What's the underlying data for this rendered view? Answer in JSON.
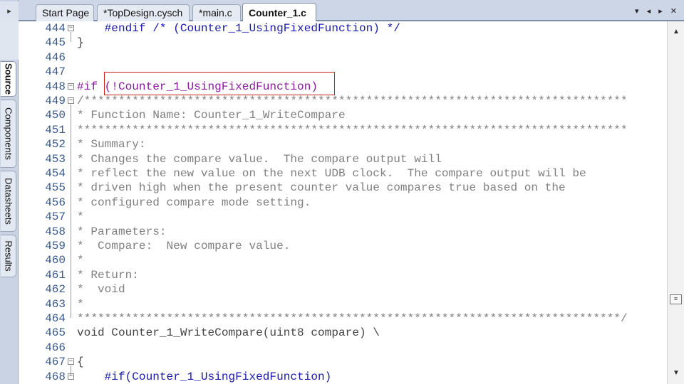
{
  "tabs": [
    {
      "label": "Start Page",
      "active": false
    },
    {
      "label": "*TopDesign.cysch",
      "active": false
    },
    {
      "label": "*main.c",
      "active": false
    },
    {
      "label": "Counter_1.c",
      "active": true
    }
  ],
  "tab_controls": "▾ ◂ ▸ ✕",
  "side_tabs": [
    "Source",
    "Components",
    "Datasheets",
    "Results"
  ],
  "lines": [
    {
      "num": "444",
      "text": "    #endif /* (Counter_1_UsingFixedFunction) */"
    },
    {
      "num": "445",
      "text": "}"
    },
    {
      "num": "446",
      "text": ""
    },
    {
      "num": "447",
      "text": ""
    },
    {
      "num": "448",
      "text": "#if (!Counter_1_UsingFixedFunction)"
    },
    {
      "num": "449",
      "text": "/*******************************************************************************"
    },
    {
      "num": "450",
      "text": "* Function Name: Counter_1_WriteCompare"
    },
    {
      "num": "451",
      "text": "********************************************************************************"
    },
    {
      "num": "452",
      "text": "* Summary:"
    },
    {
      "num": "453",
      "text": "* Changes the compare value.  The compare output will"
    },
    {
      "num": "454",
      "text": "* reflect the new value on the next UDB clock.  The compare output will be"
    },
    {
      "num": "455",
      "text": "* driven high when the present counter value compares true based on the"
    },
    {
      "num": "456",
      "text": "* configured compare mode setting."
    },
    {
      "num": "457",
      "text": "*"
    },
    {
      "num": "458",
      "text": "* Parameters:"
    },
    {
      "num": "459",
      "text": "*  Compare:  New compare value."
    },
    {
      "num": "460",
      "text": "*"
    },
    {
      "num": "461",
      "text": "* Return:"
    },
    {
      "num": "462",
      "text": "*  void"
    },
    {
      "num": "463",
      "text": "*"
    },
    {
      "num": "464",
      "text": "*******************************************************************************/"
    },
    {
      "num": "465",
      "text": "void Counter_1_WriteCompare(uint8 compare) \\"
    },
    {
      "num": "466",
      "text": ""
    },
    {
      "num": "467",
      "text": "{"
    },
    {
      "num": "468",
      "text": "    #if(Counter_1_UsingFixedFunction)"
    }
  ],
  "colors": {
    "line_number": "#3a5a8c",
    "comment": "#808080",
    "keyword": "#1a1aaa",
    "macro": "#8a1a9e",
    "highlight_border": "#cc2222"
  }
}
